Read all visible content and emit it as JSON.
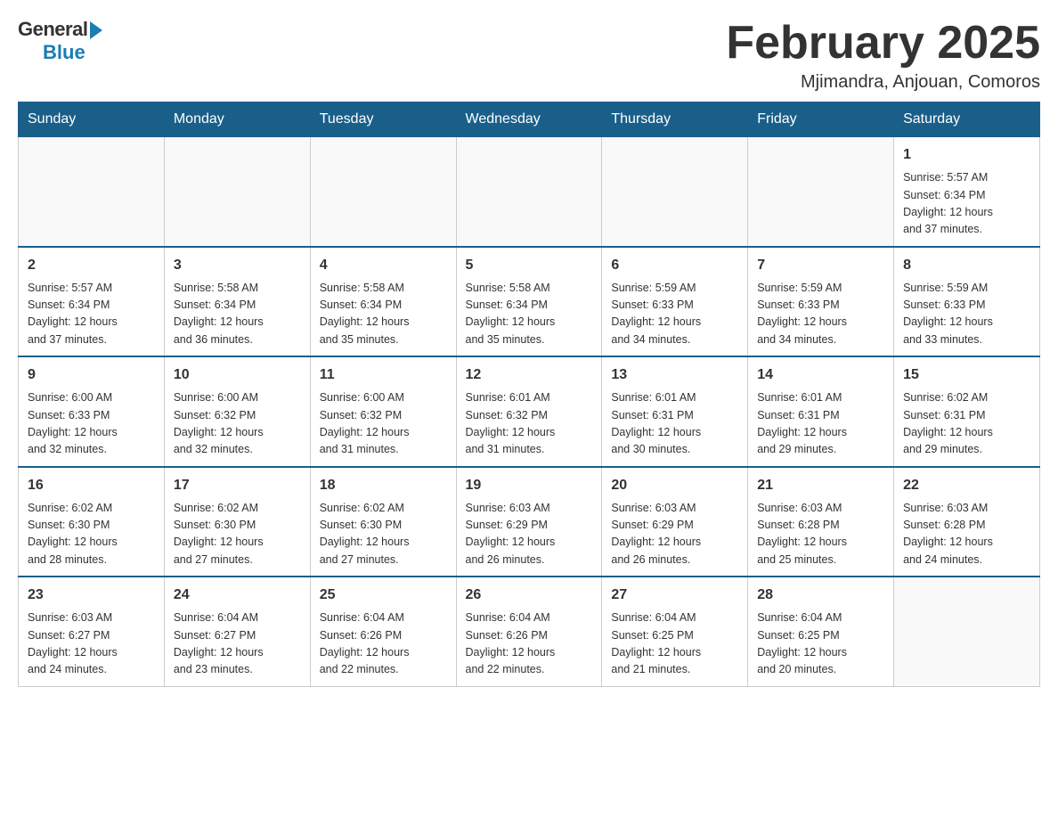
{
  "logo": {
    "general": "General",
    "blue": "Blue"
  },
  "title": "February 2025",
  "subtitle": "Mjimandra, Anjouan, Comoros",
  "days_of_week": [
    "Sunday",
    "Monday",
    "Tuesday",
    "Wednesday",
    "Thursday",
    "Friday",
    "Saturday"
  ],
  "weeks": [
    [
      {
        "day": "",
        "info": ""
      },
      {
        "day": "",
        "info": ""
      },
      {
        "day": "",
        "info": ""
      },
      {
        "day": "",
        "info": ""
      },
      {
        "day": "",
        "info": ""
      },
      {
        "day": "",
        "info": ""
      },
      {
        "day": "1",
        "info": "Sunrise: 5:57 AM\nSunset: 6:34 PM\nDaylight: 12 hours\nand 37 minutes."
      }
    ],
    [
      {
        "day": "2",
        "info": "Sunrise: 5:57 AM\nSunset: 6:34 PM\nDaylight: 12 hours\nand 37 minutes."
      },
      {
        "day": "3",
        "info": "Sunrise: 5:58 AM\nSunset: 6:34 PM\nDaylight: 12 hours\nand 36 minutes."
      },
      {
        "day": "4",
        "info": "Sunrise: 5:58 AM\nSunset: 6:34 PM\nDaylight: 12 hours\nand 35 minutes."
      },
      {
        "day": "5",
        "info": "Sunrise: 5:58 AM\nSunset: 6:34 PM\nDaylight: 12 hours\nand 35 minutes."
      },
      {
        "day": "6",
        "info": "Sunrise: 5:59 AM\nSunset: 6:33 PM\nDaylight: 12 hours\nand 34 minutes."
      },
      {
        "day": "7",
        "info": "Sunrise: 5:59 AM\nSunset: 6:33 PM\nDaylight: 12 hours\nand 34 minutes."
      },
      {
        "day": "8",
        "info": "Sunrise: 5:59 AM\nSunset: 6:33 PM\nDaylight: 12 hours\nand 33 minutes."
      }
    ],
    [
      {
        "day": "9",
        "info": "Sunrise: 6:00 AM\nSunset: 6:33 PM\nDaylight: 12 hours\nand 32 minutes."
      },
      {
        "day": "10",
        "info": "Sunrise: 6:00 AM\nSunset: 6:32 PM\nDaylight: 12 hours\nand 32 minutes."
      },
      {
        "day": "11",
        "info": "Sunrise: 6:00 AM\nSunset: 6:32 PM\nDaylight: 12 hours\nand 31 minutes."
      },
      {
        "day": "12",
        "info": "Sunrise: 6:01 AM\nSunset: 6:32 PM\nDaylight: 12 hours\nand 31 minutes."
      },
      {
        "day": "13",
        "info": "Sunrise: 6:01 AM\nSunset: 6:31 PM\nDaylight: 12 hours\nand 30 minutes."
      },
      {
        "day": "14",
        "info": "Sunrise: 6:01 AM\nSunset: 6:31 PM\nDaylight: 12 hours\nand 29 minutes."
      },
      {
        "day": "15",
        "info": "Sunrise: 6:02 AM\nSunset: 6:31 PM\nDaylight: 12 hours\nand 29 minutes."
      }
    ],
    [
      {
        "day": "16",
        "info": "Sunrise: 6:02 AM\nSunset: 6:30 PM\nDaylight: 12 hours\nand 28 minutes."
      },
      {
        "day": "17",
        "info": "Sunrise: 6:02 AM\nSunset: 6:30 PM\nDaylight: 12 hours\nand 27 minutes."
      },
      {
        "day": "18",
        "info": "Sunrise: 6:02 AM\nSunset: 6:30 PM\nDaylight: 12 hours\nand 27 minutes."
      },
      {
        "day": "19",
        "info": "Sunrise: 6:03 AM\nSunset: 6:29 PM\nDaylight: 12 hours\nand 26 minutes."
      },
      {
        "day": "20",
        "info": "Sunrise: 6:03 AM\nSunset: 6:29 PM\nDaylight: 12 hours\nand 26 minutes."
      },
      {
        "day": "21",
        "info": "Sunrise: 6:03 AM\nSunset: 6:28 PM\nDaylight: 12 hours\nand 25 minutes."
      },
      {
        "day": "22",
        "info": "Sunrise: 6:03 AM\nSunset: 6:28 PM\nDaylight: 12 hours\nand 24 minutes."
      }
    ],
    [
      {
        "day": "23",
        "info": "Sunrise: 6:03 AM\nSunset: 6:27 PM\nDaylight: 12 hours\nand 24 minutes."
      },
      {
        "day": "24",
        "info": "Sunrise: 6:04 AM\nSunset: 6:27 PM\nDaylight: 12 hours\nand 23 minutes."
      },
      {
        "day": "25",
        "info": "Sunrise: 6:04 AM\nSunset: 6:26 PM\nDaylight: 12 hours\nand 22 minutes."
      },
      {
        "day": "26",
        "info": "Sunrise: 6:04 AM\nSunset: 6:26 PM\nDaylight: 12 hours\nand 22 minutes."
      },
      {
        "day": "27",
        "info": "Sunrise: 6:04 AM\nSunset: 6:25 PM\nDaylight: 12 hours\nand 21 minutes."
      },
      {
        "day": "28",
        "info": "Sunrise: 6:04 AM\nSunset: 6:25 PM\nDaylight: 12 hours\nand 20 minutes."
      },
      {
        "day": "",
        "info": ""
      }
    ]
  ]
}
